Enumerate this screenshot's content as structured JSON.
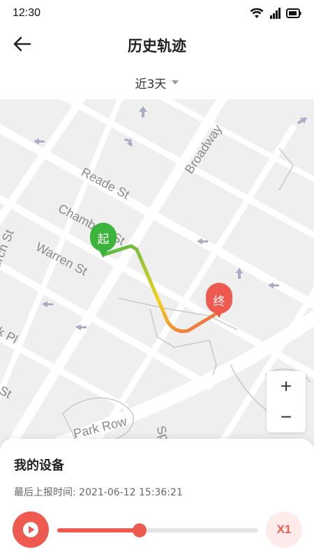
{
  "status_bar": {
    "time": "12:30"
  },
  "header": {
    "title": "历史轨迹"
  },
  "filter": {
    "label": "近3天"
  },
  "map": {
    "street_labels": [
      {
        "text": "Reade St"
      },
      {
        "text": "Broadway"
      },
      {
        "text": "Chambers St"
      },
      {
        "text": "Warren St"
      },
      {
        "text": "Church St"
      },
      {
        "text": "Park Pl"
      },
      {
        "text": "Barclay St"
      },
      {
        "text": "Park Row"
      },
      {
        "text": "Spruce St"
      }
    ],
    "start_marker": "起",
    "end_marker": "终",
    "route_colors": {
      "start": "#4cb848",
      "middle": "#f2d21a",
      "end": "#ee5a50"
    }
  },
  "zoom": {
    "in": "+",
    "out": "−"
  },
  "panel": {
    "device_name": "我的设备",
    "last_report": "最后上报时间: 2021-06-12 15:36:21",
    "progress": 0.41,
    "speed": "X1"
  },
  "colors": {
    "accent": "#ee5a50",
    "start": "#3cb43c"
  }
}
